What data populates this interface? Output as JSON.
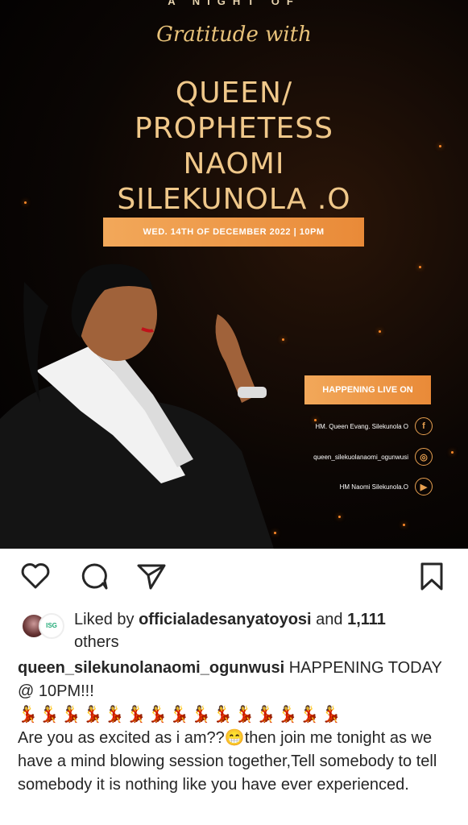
{
  "poster": {
    "top_text": "A NIGHT OF",
    "script_title": "Gratitude with",
    "name_lines": [
      "QUEEN/",
      "PROPHETESS",
      "NAOMI",
      "SILEKUNOLA .O"
    ],
    "date_banner": "WED. 14TH OF DECEMBER 2022 | 10PM",
    "live_banner": "HAPPENING LIVE ON",
    "socials": [
      {
        "label": "HM. Queen Evang. Silekunola O",
        "icon": "facebook-icon",
        "glyph": "f"
      },
      {
        "label": "queen_silekuolanaomi_ogunwusi",
        "icon": "instagram-icon",
        "glyph": "◎"
      },
      {
        "label": "HM Naomi Silekunola.O",
        "icon": "youtube-icon",
        "glyph": "▶"
      }
    ],
    "colors": {
      "accent": "#e98a38",
      "gold_text": "#f0c88a",
      "background": "#0b0604"
    }
  },
  "actions": {
    "like_icon": "heart-icon",
    "comment_icon": "comment-icon",
    "share_icon": "share-icon",
    "save_icon": "bookmark-icon"
  },
  "likes": {
    "prefix": "Liked by ",
    "user": "officialadesanyatoyosi",
    "middle": " and ",
    "count": "1,111",
    "suffix": " others",
    "avatar2_text": "ISG"
  },
  "caption": {
    "username": "queen_silekunolanaomi_ogunwusi",
    "headline": " HAPPENING TODAY @ 10PM!!!",
    "emoji_line": "💃💃💃💃💃💃💃💃💃💃💃💃💃💃💃",
    "body": "Are you as excited as i am??😁then join me tonight as we have a mind blowing session together,Tell somebody to tell somebody it is nothing like you have ever experienced."
  }
}
